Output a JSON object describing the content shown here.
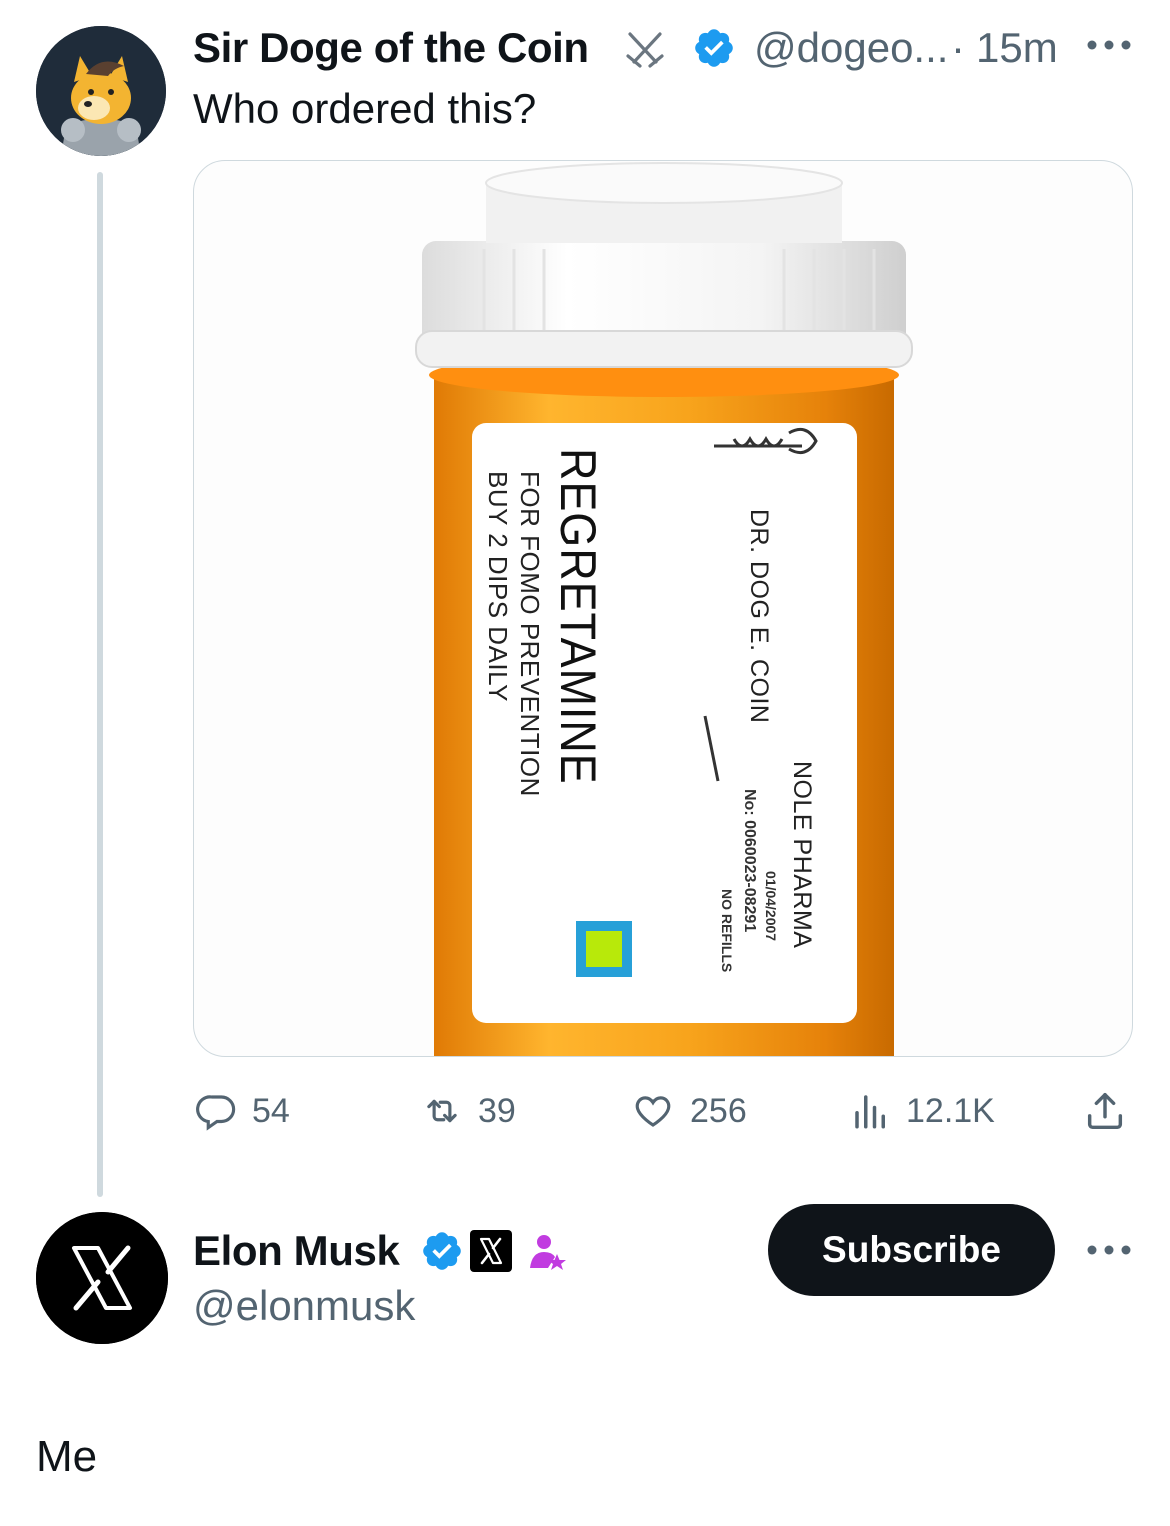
{
  "tweet": {
    "author_name": "Sir Doge of the Coin",
    "handle": "@dogeo...",
    "separator": "·",
    "time": "15m",
    "text": "Who ordered this?",
    "media": {
      "label_name": "REGRETAMINE",
      "label_use": "FOR FOMO PREVENTION",
      "label_dose": "BUY 2 DIPS DAILY",
      "label_doctor": "DR. DOG E. COIN",
      "label_pharmacy": "NOLE PHARMA",
      "label_date": "01/04/2007",
      "label_number": "No: 0060023-08291",
      "label_refills": "NO REFILLS"
    },
    "actions": {
      "replies": "54",
      "reposts": "39",
      "likes": "256",
      "views": "12.1K"
    }
  },
  "profile": {
    "name": "Elon Musk",
    "handle": "@elonmusk",
    "subscribe_label": "Subscribe"
  },
  "caption": "Me",
  "colors": {
    "verified": "#1d9bf0",
    "muted": "#536471",
    "bottle_orange": "#f59a12",
    "affiliate_purple": "#c13ce0"
  }
}
